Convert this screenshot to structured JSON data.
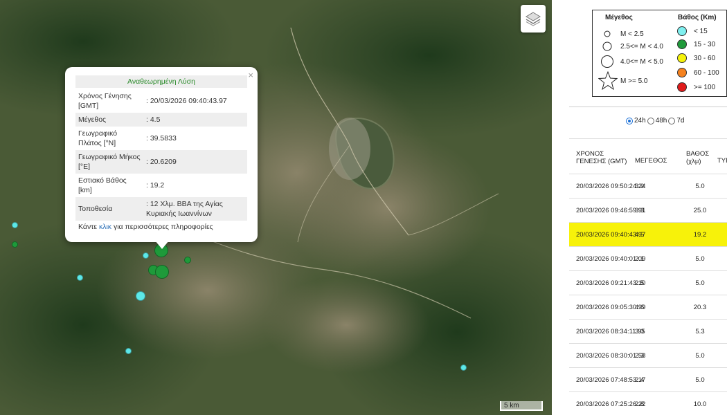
{
  "map": {
    "scale_label": "5 km",
    "layers_icon": "layers-icon",
    "quakes": [
      {
        "depth_class": "< 15",
        "color": "#5ce8e8",
        "magnitude_class": "M < 2.5"
      },
      {
        "depth_class": "15 - 30",
        "color": "#1e9a3a",
        "magnitude_class": "2.5<= M < 4.0"
      },
      {
        "depth_class": "15 - 30",
        "color": "#1e9a3a",
        "magnitude_class": "4.0<= M < 5.0"
      }
    ]
  },
  "popup": {
    "title": "Αναθεωρημένη Λύση",
    "close_label": "×",
    "rows": [
      {
        "label": "Χρόνος Γένησης [GMT]",
        "value": ": 20/03/2026 09:40:43.97"
      },
      {
        "label": "Μέγεθος",
        "value": ": 4.5"
      },
      {
        "label": "Γεωγραφικό Πλάτος [°N]",
        "value": ": 39.5833"
      },
      {
        "label": "Γεωγραφικό Μήκος [°E]",
        "value": ": 20.6209"
      },
      {
        "label": "Εστιακό Βάθος [km]",
        "value": ": 19.2"
      },
      {
        "label": "Τοποθεσία",
        "value": ": 12 Χλμ. ΒΒΑ της Αγίας Κυριακής Ιωαννίνων"
      }
    ],
    "more_prefix": "Κάντε ",
    "more_link": "κλικ",
    "more_suffix": " για περισσότερες πληροφορίες"
  },
  "legend": {
    "magnitude_title": "Μέγεθος",
    "depth_title": "Βάθος (Km)",
    "magnitude_items": [
      "M < 2.5",
      "2.5<= M < 4.0",
      "4.0<= M < 5.0",
      "M >= 5.0"
    ],
    "depth_items": [
      {
        "label": "< 15",
        "color": "#7ff0f0"
      },
      {
        "label": "15 - 30",
        "color": "#1f9a3a"
      },
      {
        "label": "30 - 60",
        "color": "#f5f20a"
      },
      {
        "label": "60 - 100",
        "color": "#f5821f"
      },
      {
        "label": ">= 100",
        "color": "#e01b1b"
      }
    ]
  },
  "range": {
    "options": [
      "24h",
      "48h",
      "7d"
    ],
    "selected": "24h"
  },
  "table": {
    "headers": [
      "ΧΡΟΝΟΣ ΓΕΝΕΣΗΣ (GMT)",
      "ΜΕΓΕΘΟΣ",
      "ΒΑΘΟΣ (χλμ)",
      "ΤΥΠ"
    ],
    "highlight_color": "#f7f20a",
    "rows": [
      {
        "time": "20/03/2026 09:50:24.24",
        "mag": "3.9",
        "depth": "5.0"
      },
      {
        "time": "20/03/2026 09:46:59.91",
        "mag": "3.3",
        "depth": "25.0"
      },
      {
        "time": "20/03/2026 09:40:43.97",
        "mag": "4.5",
        "depth": "19.2",
        "highlighted": true
      },
      {
        "time": "20/03/2026 09:40:01.09",
        "mag": "2.1",
        "depth": "5.0"
      },
      {
        "time": "20/03/2026 09:21:43.10",
        "mag": "2.5",
        "depth": "5.0"
      },
      {
        "time": "20/03/2026 09:05:30.99",
        "mag": "4.6",
        "depth": "20.3"
      },
      {
        "time": "20/03/2026 08:34:11.95",
        "mag": "3.0",
        "depth": "5.3"
      },
      {
        "time": "20/03/2026 08:30:01.58",
        "mag": "2.3",
        "depth": "5.0"
      },
      {
        "time": "20/03/2026 07:48:53.17",
        "mag": "2.4",
        "depth": "5.0"
      },
      {
        "time": "20/03/2026 07:25:26.22",
        "mag": "2.8",
        "depth": "10.0"
      }
    ]
  }
}
